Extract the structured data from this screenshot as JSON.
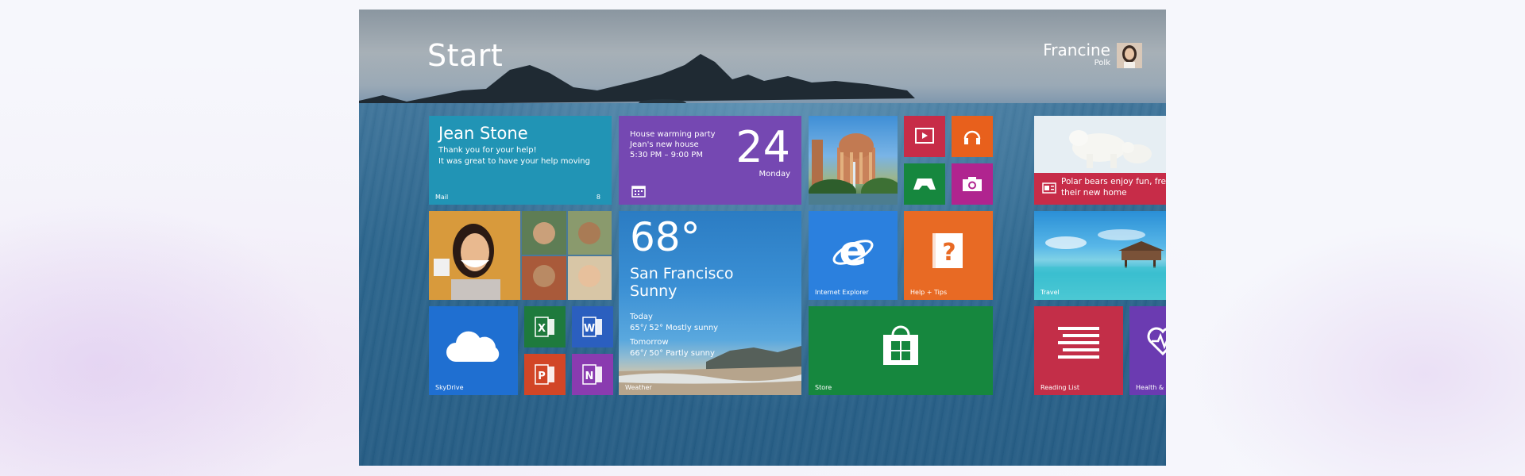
{
  "start": {
    "title": "Start"
  },
  "user": {
    "first_name": "Francine",
    "last_name": "Polk"
  },
  "tiles": {
    "mail": {
      "sender": "Jean Stone",
      "line1": "Thank you for your help!",
      "line2": "It was great to have your help moving",
      "label": "Mail",
      "badge": "8"
    },
    "calendar": {
      "event": "House warming party",
      "location": "Jean's new house",
      "time": "5:30 PM – 9:00 PM",
      "day": "24",
      "weekday": "Monday"
    },
    "weather": {
      "temperature": "68°",
      "city": "San Francisco",
      "condition": "Sunny",
      "today_label": "Today",
      "today_forecast": "65°/ 52° Mostly sunny",
      "tomorrow_label": "Tomorrow",
      "tomorrow_forecast": "66°/ 50° Partly sunny",
      "label": "Weather"
    },
    "skydrive": {
      "label": "SkyDrive"
    },
    "internet_explorer": {
      "label": "Internet Explorer"
    },
    "help": {
      "label": "Help + Tips"
    },
    "store": {
      "label": "Store"
    },
    "news": {
      "headline_line1": "Polar bears enjoy fun, fre",
      "headline_line2": "their new home"
    },
    "travel": {
      "label": "Travel"
    },
    "reading_list": {
      "label": "Reading List"
    },
    "health": {
      "label": "Health &"
    }
  },
  "colors": {
    "mail": "#2194b5",
    "calendar": "#7548b2",
    "excel": "#1e7a3d",
    "word": "#2b5fbf",
    "powerpoint": "#d24626",
    "onenote": "#8a3bb0",
    "video": "#c72c48",
    "music": "#e8601c",
    "games": "#16873e",
    "camera": "#b0248f"
  },
  "icons": {
    "skydrive": "cloud-icon",
    "excel": "excel-icon",
    "word": "word-icon",
    "powerpoint": "powerpoint-icon",
    "onenote": "onenote-icon",
    "video": "video-icon",
    "music": "headphones-icon",
    "games": "gamepad-icon",
    "camera": "camera-icon",
    "ie": "internet-explorer-icon",
    "help": "help-icon",
    "store": "store-bag-icon",
    "reading": "reading-list-icon",
    "health": "health-heart-icon",
    "calendar": "calendar-icon"
  }
}
